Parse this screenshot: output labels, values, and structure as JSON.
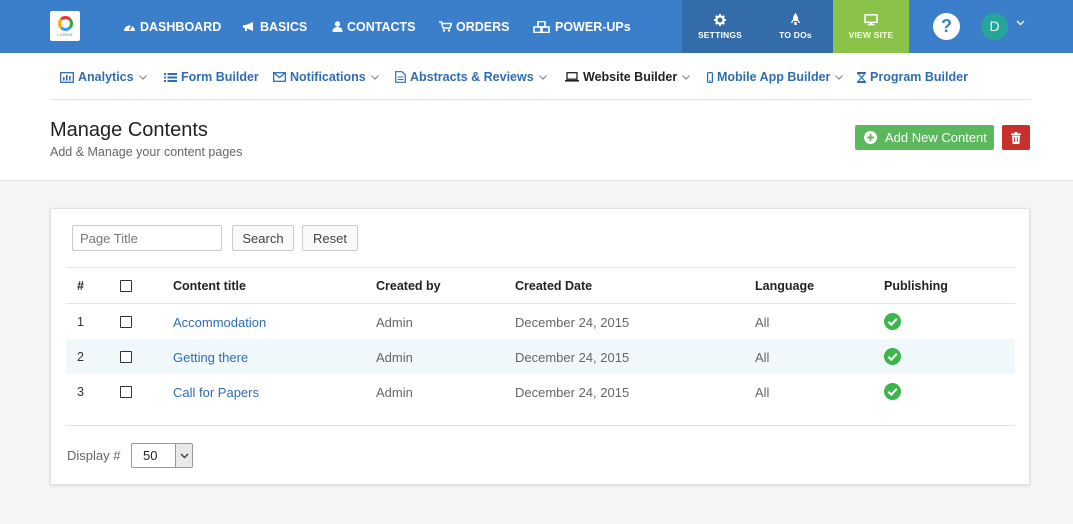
{
  "colors": {
    "topbar": "#3b7fcb",
    "topbar_dark_tile": "#346ba9",
    "view_site_tile": "#8bc34a",
    "link": "#2f6db1",
    "success": "#5cb85c",
    "danger": "#c9302c",
    "avatar": "#26a69a",
    "publish_check": "#3cb54a"
  },
  "topbar": {
    "logo_text": "LOREM",
    "nav": [
      {
        "label": "DASHBOARD",
        "icon": "dashboard-icon"
      },
      {
        "label": "BASICS",
        "icon": "bullhorn-icon"
      },
      {
        "label": "CONTACTS",
        "icon": "user-icon"
      },
      {
        "label": "ORDERS",
        "icon": "cart-icon"
      },
      {
        "label": "POWER-UPs",
        "icon": "cubes-icon"
      }
    ],
    "tiles": {
      "settings": "SETTINGS",
      "todos": "TO DOs",
      "view_site": "VIEW SITE"
    },
    "help": "?",
    "avatar_initial": "D"
  },
  "subnav": [
    {
      "label": "Analytics",
      "icon": "analytics-icon",
      "dropdown": true
    },
    {
      "label": "Form Builder",
      "icon": "list-icon",
      "dropdown": false
    },
    {
      "label": "Notifications",
      "icon": "envelope-icon",
      "dropdown": true
    },
    {
      "label": "Abstracts & Reviews",
      "icon": "document-icon",
      "dropdown": true
    },
    {
      "label": "Website Builder",
      "icon": "laptop-icon",
      "dropdown": true,
      "active": true
    },
    {
      "label": "Mobile App Builder",
      "icon": "mobile-icon",
      "dropdown": true
    },
    {
      "label": "Program Builder",
      "icon": "hourglass-icon",
      "dropdown": false
    }
  ],
  "header": {
    "title": "Manage Contents",
    "subtitle": "Add & Manage your content pages",
    "add_button": "Add New Content"
  },
  "search": {
    "placeholder": "Page Title",
    "value": "",
    "search_label": "Search",
    "reset_label": "Reset"
  },
  "table": {
    "headers": {
      "number": "#",
      "title": "Content title",
      "created_by": "Created by",
      "created_date": "Created Date",
      "language": "Language",
      "publishing": "Publishing"
    },
    "rows": [
      {
        "num": "1",
        "title": "Accommodation",
        "created_by": "Admin",
        "created_date": "December 24, 2015",
        "language": "All",
        "published": true
      },
      {
        "num": "2",
        "title": "Getting there",
        "created_by": "Admin",
        "created_date": "December 24, 2015",
        "language": "All",
        "published": true
      },
      {
        "num": "3",
        "title": "Call for Papers",
        "created_by": "Admin",
        "created_date": "December 24, 2015",
        "language": "All",
        "published": true
      }
    ]
  },
  "pagination": {
    "display_label": "Display #",
    "display_value": "50"
  }
}
